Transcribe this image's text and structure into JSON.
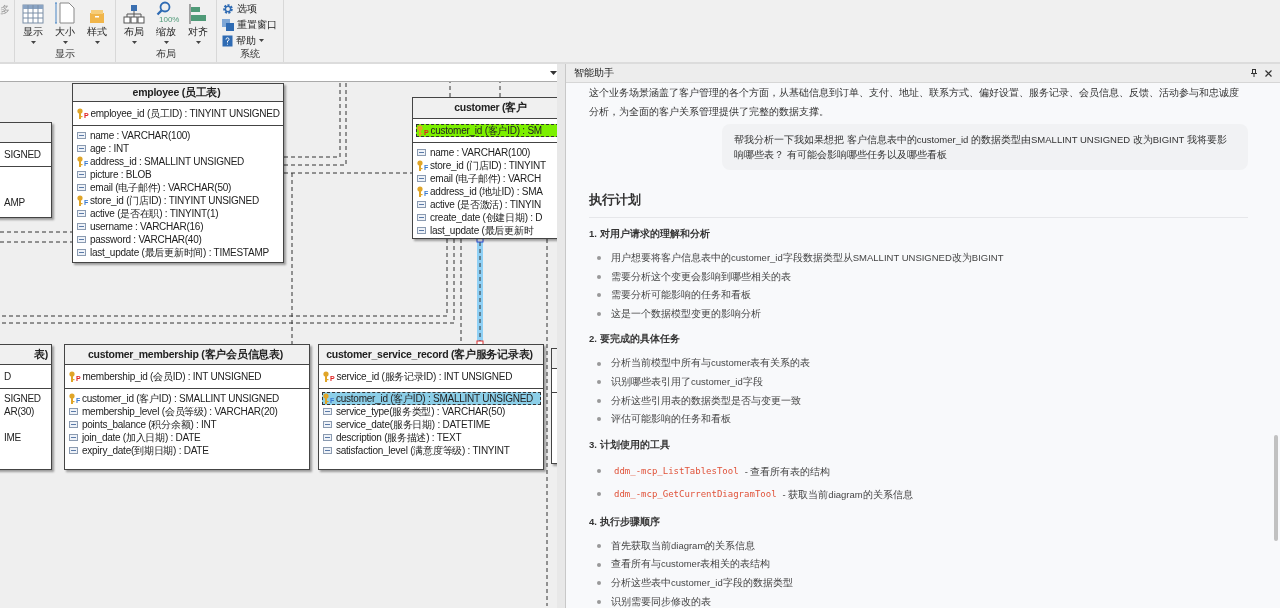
{
  "ribbon": {
    "overflow_label": "多",
    "groups": [
      {
        "label": "显示",
        "kind": "large",
        "buttons": [
          {
            "label": "显示",
            "dropdown": true
          },
          {
            "label": "大小",
            "dropdown": true
          },
          {
            "label": "样式",
            "dropdown": true
          }
        ]
      },
      {
        "label": "布局",
        "kind": "large",
        "buttons": [
          {
            "label": "布局",
            "dropdown": true
          },
          {
            "label": "缩放",
            "dropdown": true,
            "badge": "100%"
          },
          {
            "label": "对齐",
            "dropdown": true
          }
        ]
      },
      {
        "label": "系统",
        "kind": "small",
        "buttons": [
          {
            "label": "选项",
            "dropdown": false
          },
          {
            "label": "重置窗口",
            "dropdown": false
          },
          {
            "label": "帮助",
            "dropdown": true
          }
        ]
      }
    ]
  },
  "diagram": {
    "tables": [
      {
        "kind": "cut",
        "key_fields": [
          {
            "text": "SIGNED"
          }
        ],
        "fields": [
          {
            "text": "AMP"
          }
        ]
      },
      {
        "kind": "full",
        "title": "employee (员工表)",
        "key_fields": [
          {
            "text": "employee_id (员工ID) : TINYINT UNSIGNED",
            "key": "P"
          }
        ],
        "fields": [
          {
            "text": "name : VARCHAR(100)"
          },
          {
            "text": "age : INT"
          },
          {
            "text": "address_id : SMALLINT UNSIGNED",
            "key": "F"
          },
          {
            "text": "picture : BLOB"
          },
          {
            "text": "email (电子邮件) : VARCHAR(50)"
          },
          {
            "text": "store_id (门店ID) : TINYINT UNSIGNED",
            "key": "F"
          },
          {
            "text": "active (是否在职) : TINYINT(1)"
          },
          {
            "text": "username : VARCHAR(16)"
          },
          {
            "text": "password : VARCHAR(40)"
          },
          {
            "text": "last_update (最后更新时间) : TIMESTAMP"
          }
        ]
      },
      {
        "kind": "full",
        "title": "customer (客户",
        "key_fields": [
          {
            "text": "customer_id (客户ID) : SM",
            "key": "P",
            "matched": true
          }
        ],
        "fields": [
          {
            "text": "name : VARCHAR(100)"
          },
          {
            "text": "store_id (门店ID) : TINYINT",
            "key": "F"
          },
          {
            "text": "email (电子邮件) : VARCH"
          },
          {
            "text": "address_id (地址ID) : SMA",
            "key": "F"
          },
          {
            "text": "active (是否激活) : TINYIN"
          },
          {
            "text": "create_date (创建日期) : D"
          },
          {
            "text": "last_update (最后更新时"
          }
        ]
      },
      {
        "kind": "cut",
        "title": "表)",
        "key_fields": [
          {
            "text": "D"
          }
        ],
        "fields": [
          {
            "text": "SIGNED"
          },
          {
            "text": "AR(30)"
          },
          {
            "text": "IME"
          }
        ]
      },
      {
        "kind": "full",
        "title": "customer_membership (客户会员信息表)",
        "key_fields": [
          {
            "text": "membership_id  (会员ID) : INT UNSIGNED",
            "key": "P"
          }
        ],
        "fields": [
          {
            "text": "customer_id (客户ID) : SMALLINT UNSIGNED",
            "key": "F"
          },
          {
            "text": "membership_level  (会员等级) : VARCHAR(20)"
          },
          {
            "text": "points_balance (积分余额) : INT"
          },
          {
            "text": "join_date (加入日期) : DATE"
          },
          {
            "text": "expiry_date(到期日期) : DATE"
          }
        ]
      },
      {
        "kind": "full",
        "title": "customer_service_record (客户服务记录表)",
        "key_fields": [
          {
            "text": "service_id (服务记录ID) : INT UNSIGNED",
            "key": "P"
          }
        ],
        "fields": [
          {
            "text": "customer_id (客户ID) : SMALLINT UNSIGNED",
            "key": "F",
            "selected": true
          },
          {
            "text": "service_type(服务类型) : VARCHAR(50)"
          },
          {
            "text": "service_date(服务日期) : DATETIME"
          },
          {
            "text": "description (服务描述) : TEXT"
          },
          {
            "text": "satisfaction_level (满意度等级) : TINYINT"
          }
        ]
      },
      {
        "kind": "cut"
      }
    ]
  },
  "assistant": {
    "title": "智能助手",
    "intro": "这个业务场景涵盖了客户管理的各个方面，从基础信息到订单、支付、地址、联系方式、偏好设置、服务记录、会员信息、反馈、活动参与和忠诚度分析，为全面的客户关系管理提供了完整的数据支撑。",
    "user_message": "帮我分析一下我如果想把 客户信息表中的customer_id 的数据类型由SMALLINT UNSIGNED 改为BIGINT 我将要影响哪些表？ 有可能会影响哪些任务以及哪些看板",
    "plan": {
      "heading": "执行计划",
      "sections": [
        {
          "title": "1. 对用户请求的理解和分析",
          "items": [
            {
              "text": "用户想要将客户信息表中的customer_id字段数据类型从SMALLINT UNSIGNED改为BIGINT"
            },
            {
              "text": "需要分析这个变更会影响到哪些相关的表"
            },
            {
              "text": "需要分析可能影响的任务和看板"
            },
            {
              "text": "这是一个数据模型变更的影响分析"
            }
          ]
        },
        {
          "title": "2. 要完成的具体任务",
          "items": [
            {
              "text": "分析当前模型中所有与customer表有关系的表"
            },
            {
              "text": "识别哪些表引用了customer_id字段"
            },
            {
              "text": "分析这些引用表的数据类型是否与变更一致"
            },
            {
              "text": "评估可能影响的任务和看板"
            }
          ]
        },
        {
          "title": "3. 计划使用的工具",
          "items": [
            {
              "code": "ddm_-mcp_ListTablesTool",
              "text": "- 查看所有表的结构"
            },
            {
              "code": "ddm_-mcp_GetCurrentDiagramTool",
              "text": "- 获取当前diagram的关系信息"
            }
          ]
        },
        {
          "title": "4. 执行步骤顺序",
          "items": [
            {
              "text": "首先获取当前diagram的关系信息"
            },
            {
              "text": "查看所有与customer表相关的表结构"
            },
            {
              "text": "分析这些表中customer_id字段的数据类型"
            },
            {
              "text": "识别需要同步修改的表"
            }
          ]
        }
      ]
    }
  }
}
